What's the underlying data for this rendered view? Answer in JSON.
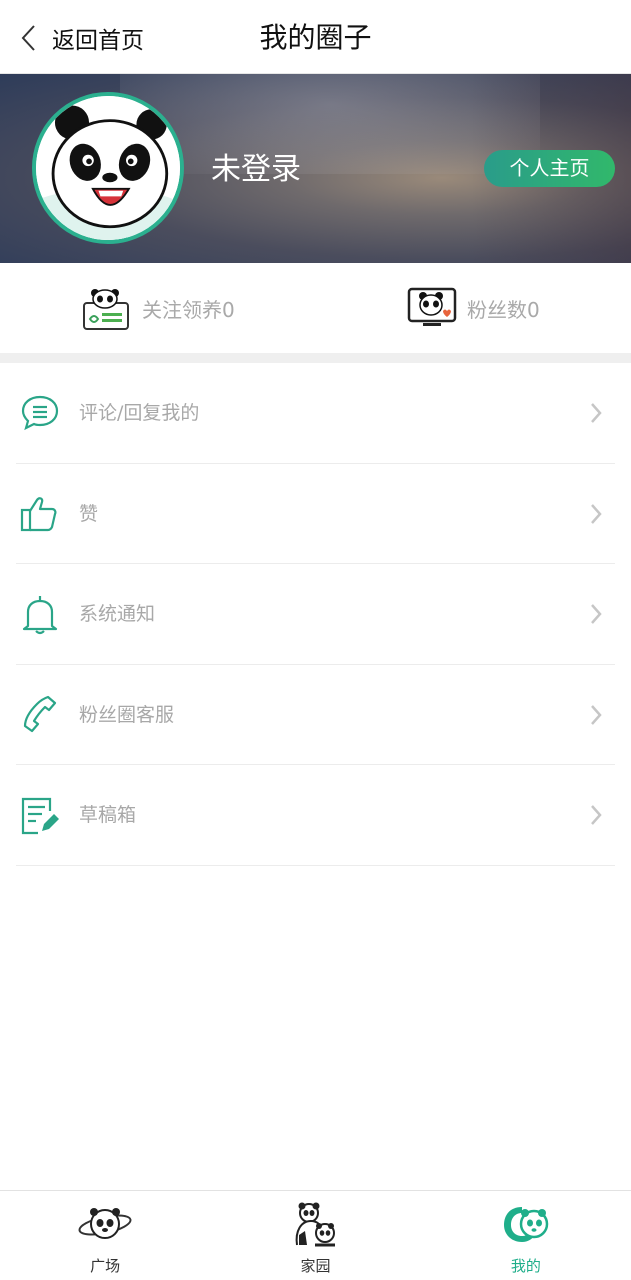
{
  "header": {
    "back_label": "返回首页",
    "title": "我的圈子"
  },
  "profile": {
    "username": "未登录",
    "homepage_button": "个人主页"
  },
  "stats": {
    "follow": "关注领养0",
    "fans": "粉丝数0"
  },
  "menu": {
    "items": [
      {
        "label": "评论/回复我的",
        "icon": "comment-icon"
      },
      {
        "label": "赞",
        "icon": "thumbs-up-icon"
      },
      {
        "label": "系统通知",
        "icon": "bell-icon"
      },
      {
        "label": "粉丝圈客服",
        "icon": "phone-icon"
      },
      {
        "label": "草稿箱",
        "icon": "draft-edit-icon"
      }
    ]
  },
  "bottom_nav": {
    "items": [
      {
        "label": "广场",
        "icon": "panda-planet-icon"
      },
      {
        "label": "家园",
        "icon": "panda-family-icon"
      },
      {
        "label": "我的",
        "icon": "panda-me-icon",
        "active": true
      }
    ]
  },
  "colors": {
    "accent": "#1fae8a",
    "avatar_ring": "#2bb08f",
    "button_gradient_start": "#2a9c8a",
    "button_gradient_end": "#31b86b",
    "text_muted": "#a8a8a8"
  }
}
